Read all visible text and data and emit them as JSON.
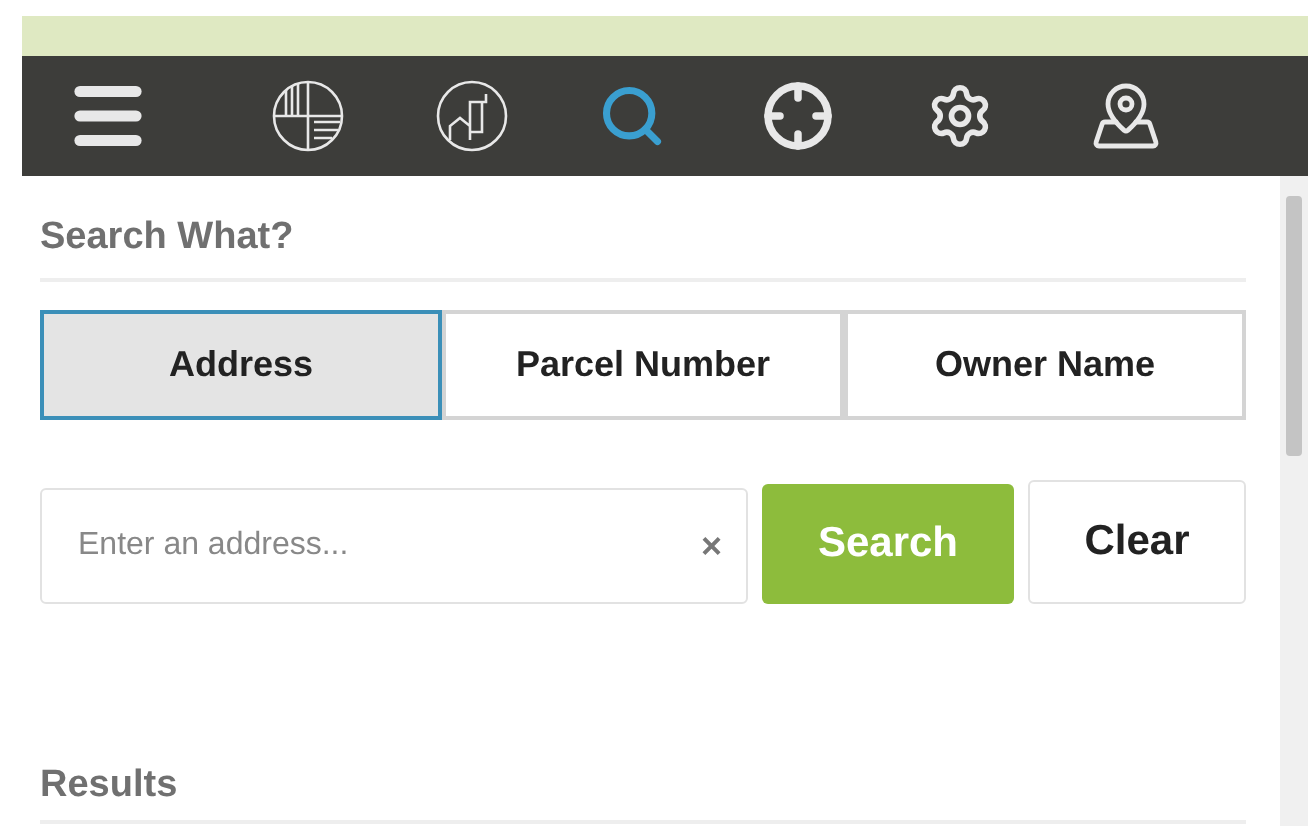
{
  "toolbar": {
    "items": [
      {
        "kind": "menu",
        "selected": false
      },
      {
        "kind": "parcels",
        "selected": false
      },
      {
        "kind": "building",
        "selected": false
      },
      {
        "kind": "search",
        "selected": true
      },
      {
        "kind": "locate",
        "selected": false
      },
      {
        "kind": "settings",
        "selected": false
      },
      {
        "kind": "map",
        "selected": false
      }
    ]
  },
  "search": {
    "heading": "Search What?",
    "tabs": [
      {
        "label": "Address",
        "selected": true
      },
      {
        "label": "Parcel Number",
        "selected": false
      },
      {
        "label": "Owner Name",
        "selected": false
      }
    ],
    "field": {
      "placeholder": "Enter an address...",
      "clear_glyph": "×"
    },
    "buttons": [
      {
        "kind": "primary",
        "label": "Search"
      },
      {
        "kind": "secondary",
        "label": "Clear"
      }
    ]
  },
  "results": {
    "heading": "Results"
  }
}
